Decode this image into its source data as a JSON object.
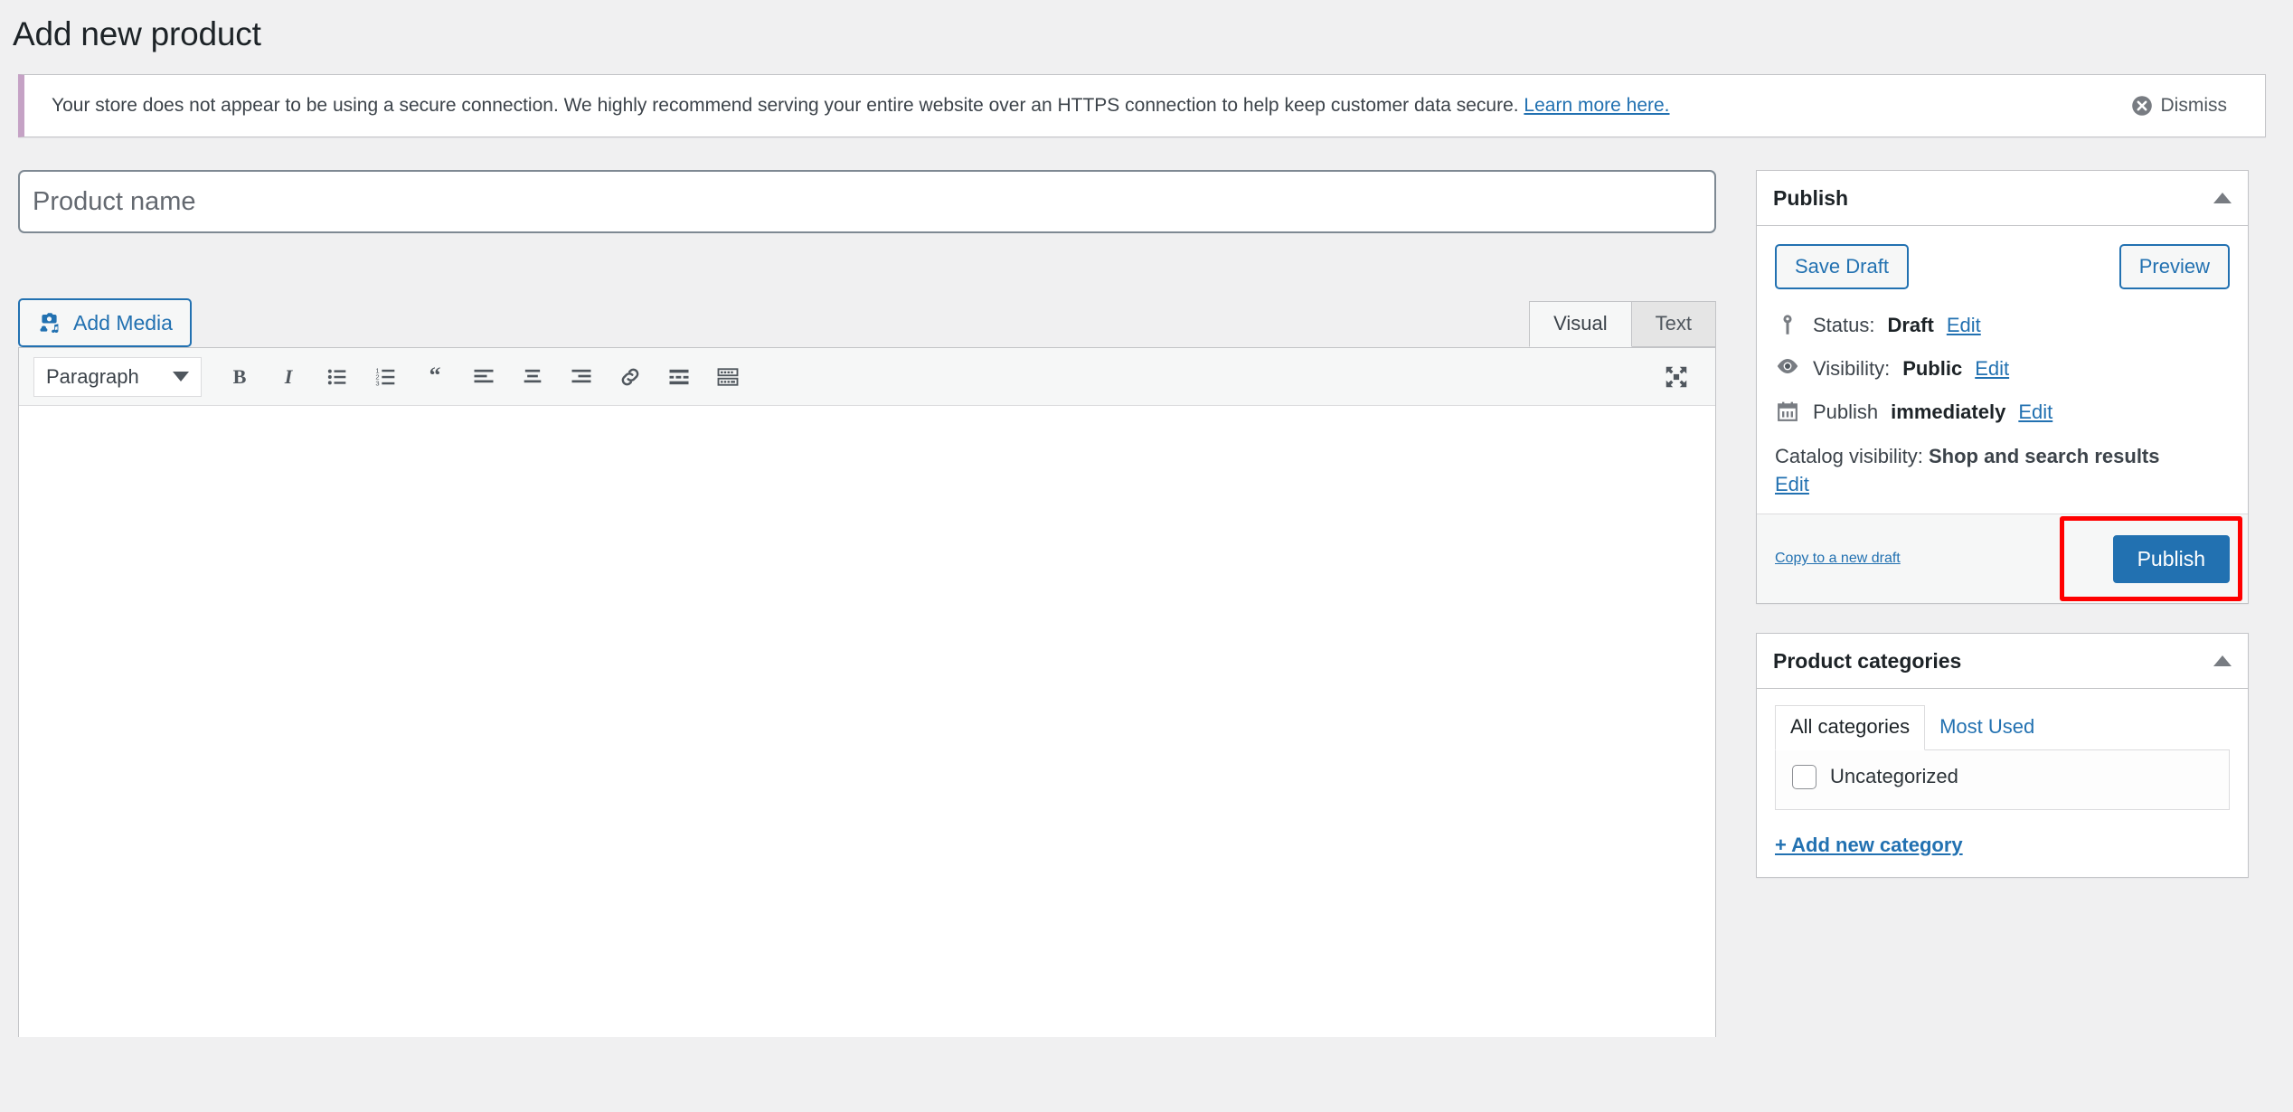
{
  "page": {
    "title": "Add new product"
  },
  "notice": {
    "text_before_link": "Your store does not appear to be using a secure connection. We highly recommend serving your entire website over an HTTPS connection to help keep customer data secure.",
    "link_label": "Learn more here.",
    "dismiss_label": "Dismiss",
    "dismiss_icon": "close-circle-icon",
    "accent_color": "#c5a2c5",
    "link_color": "#2271b1"
  },
  "product_title": {
    "placeholder": "Product name",
    "value": ""
  },
  "editor": {
    "add_media_label": "Add Media",
    "add_media_icon": "media-camera-music-icon",
    "tabs": [
      {
        "label": "Visual",
        "active": true
      },
      {
        "label": "Text",
        "active": false
      }
    ],
    "format_select": {
      "value": "Paragraph",
      "icon": "chevron-down-icon"
    },
    "toolbar_buttons": [
      {
        "name": "bold-icon",
        "label": "Bold"
      },
      {
        "name": "italic-icon",
        "label": "Italic"
      },
      {
        "name": "bulleted-list-icon",
        "label": "Bulleted list"
      },
      {
        "name": "numbered-list-icon",
        "label": "Numbered list"
      },
      {
        "name": "blockquote-icon",
        "label": "Blockquote"
      },
      {
        "name": "align-left-icon",
        "label": "Align left"
      },
      {
        "name": "align-center-icon",
        "label": "Align center"
      },
      {
        "name": "align-right-icon",
        "label": "Align right"
      },
      {
        "name": "link-icon",
        "label": "Insert/edit link"
      },
      {
        "name": "read-more-icon",
        "label": "Insert Read More tag"
      },
      {
        "name": "toolbar-toggle-icon",
        "label": "Toolbar Toggle"
      }
    ],
    "fullscreen_icon": "fullscreen-expand-icon",
    "content": ""
  },
  "publish_panel": {
    "title": "Publish",
    "toggle_icon": "triangle-up-icon",
    "save_draft_label": "Save Draft",
    "preview_label": "Preview",
    "rows": [
      {
        "icon": "pin-icon",
        "label": "Status:",
        "value": "Draft",
        "edit_label": "Edit"
      },
      {
        "icon": "eye-icon",
        "label": "Visibility:",
        "value": "Public",
        "edit_label": "Edit"
      },
      {
        "icon": "calendar-icon",
        "label": "Publish",
        "value": "immediately",
        "edit_label": "Edit"
      }
    ],
    "catalog": {
      "label": "Catalog visibility:",
      "value": "Shop and search results",
      "edit_label": "Edit"
    },
    "copy_draft_label": "Copy to a new draft",
    "publish_label": "Publish",
    "highlight_color": "#ff0000",
    "primary_color": "#2271b1"
  },
  "categories_panel": {
    "title": "Product categories",
    "toggle_icon": "triangle-up-icon",
    "tabs": [
      {
        "label": "All categories",
        "active": true
      },
      {
        "label": "Most Used",
        "active": false
      }
    ],
    "items": [
      {
        "label": "Uncategorized",
        "checked": false
      }
    ],
    "add_new_label": "+ Add new category"
  }
}
